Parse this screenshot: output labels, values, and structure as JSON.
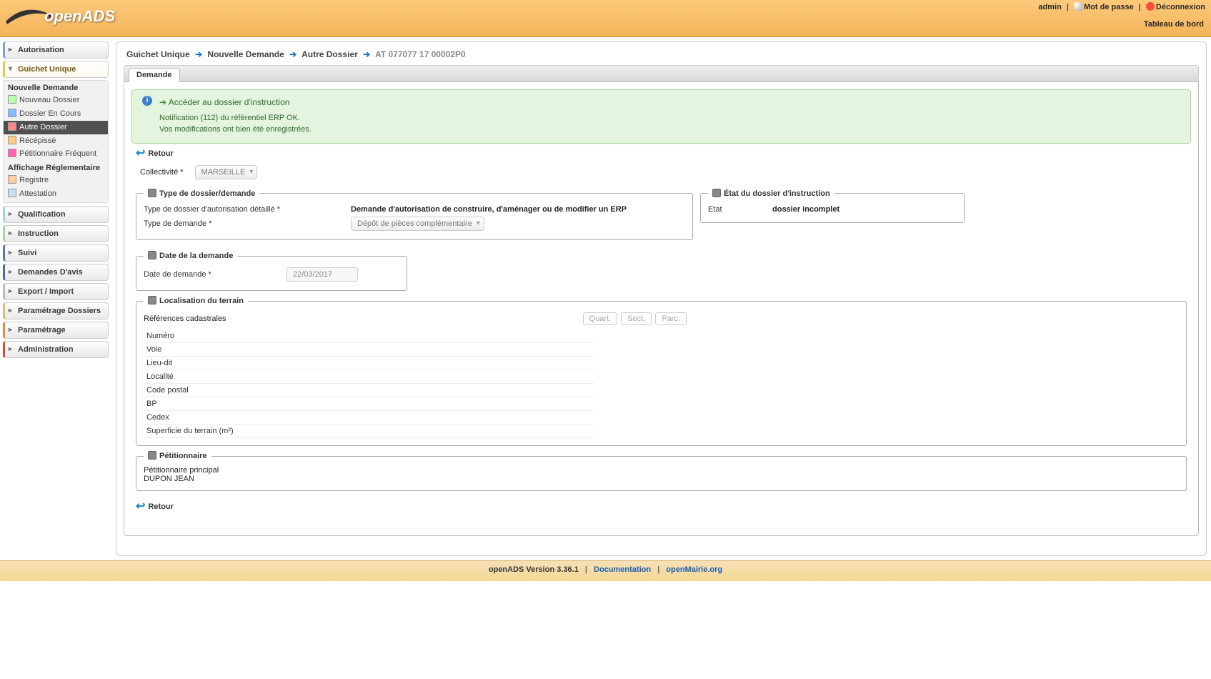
{
  "header": {
    "logo_a": "open",
    "logo_b": "ADS",
    "user": "admin",
    "mdp": "Mot de passe",
    "logout": "Déconnexion",
    "dashboard": "Tableau de bord"
  },
  "menu": {
    "autorisation": "Autorisation",
    "guichet": "Guichet Unique",
    "qualification": "Qualification",
    "instruction": "Instruction",
    "suivi": "Suivi",
    "demandes_avis": "Demandes D'avis",
    "export_import": "Export / Import",
    "param_dossiers": "Paramétrage Dossiers",
    "parametrage": "Paramétrage",
    "administration": "Administration",
    "nd_title": "Nouvelle Demande",
    "nd_items": [
      "Nouveau Dossier",
      "Dossier En Cours",
      "Autre Dossier",
      "Récépissé",
      "Pétitionnaire Fréquent"
    ],
    "nd_active_index": 2,
    "ar_title": "Affichage Réglementaire",
    "ar_items": [
      "Registre",
      "Attestation"
    ]
  },
  "breadcrumb": [
    "Guichet Unique",
    "Nouvelle Demande",
    "Autre Dossier",
    "AT 077077 17 00002P0"
  ],
  "tab": "Demande",
  "msg": {
    "link": "Accéder au dossier d'instruction",
    "line1": "Notification (112) du référentiel ERP OK.",
    "line2": "Vos modifications ont bien été enregistrées."
  },
  "retour": "Retour",
  "collectivite": {
    "label": "Collectivité *",
    "value": "MARSEILLE"
  },
  "type_dd": {
    "legend": "Type de dossier/demande",
    "l1": "Type de dossier d'autorisation détaillé *",
    "v1": "Demande d'autorisation de construire, d'aménager ou de modifier un ERP",
    "l2": "Type de demande *",
    "v2": "Dépôt de pièces complémentaire"
  },
  "etat": {
    "legend": "État du dossier d'instruction",
    "lbl": "Etat",
    "val": "dossier incomplet"
  },
  "date": {
    "legend": "Date de la demande",
    "lbl": "Date de demande *",
    "val": "22/03/2017"
  },
  "loc": {
    "legend": "Localisation du terrain",
    "refcad": "Références cadastrales",
    "btns": [
      "Quart.",
      "Sect.",
      "Parc."
    ],
    "rows": [
      "Numéro",
      "Voie",
      "Lieu-dit",
      "Localité",
      "Code postal",
      "BP",
      "Cedex",
      "Superficie du terrain (m²)"
    ]
  },
  "petit": {
    "legend": "Pétitionnaire",
    "l1": "Pétitionnaire principal",
    "l2": "DUPON JEAN"
  },
  "footer": {
    "version": "openADS Version 3.36.1",
    "doc": "Documentation",
    "om": "openMairie.org"
  }
}
